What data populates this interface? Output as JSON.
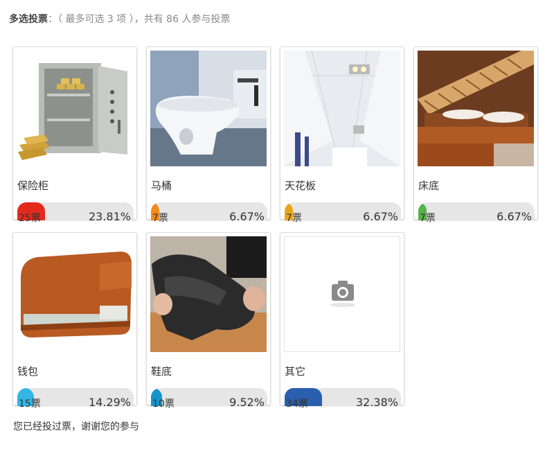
{
  "header": {
    "title": "多选投票",
    "rule": "：（ 最多可选 3 项 ），共有 86 人参与投票"
  },
  "options": [
    {
      "label": "保险柜",
      "votes": "25票",
      "percent": "23.81%",
      "share": 0.2381,
      "color": "#e42a1d",
      "image": "safe-image"
    },
    {
      "label": "马桶",
      "votes": "7票",
      "percent": "6.67%",
      "share": 0.0667,
      "color": "#ef8b1c",
      "image": "toilet-image"
    },
    {
      "label": "天花板",
      "votes": "7票",
      "percent": "6.67%",
      "share": 0.0667,
      "color": "#e9a61c",
      "image": "ceiling-image"
    },
    {
      "label": "床底",
      "votes": "7票",
      "percent": "6.67%",
      "share": 0.0667,
      "color": "#54b249",
      "image": "bed-image"
    },
    {
      "label": "钱包",
      "votes": "15票",
      "percent": "14.29%",
      "share": 0.1429,
      "color": "#34b6e4",
      "image": "wallet-image"
    },
    {
      "label": "鞋底",
      "votes": "10票",
      "percent": "9.52%",
      "share": 0.0952,
      "color": "#1794c9",
      "image": "shoe-image"
    },
    {
      "label": "其它",
      "votes": "34票",
      "percent": "32.38%",
      "share": 0.3238,
      "color": "#2a5fad",
      "image": "camera-placeholder-icon"
    }
  ],
  "footer": {
    "text": "您已经投过票，谢谢您的参与"
  }
}
